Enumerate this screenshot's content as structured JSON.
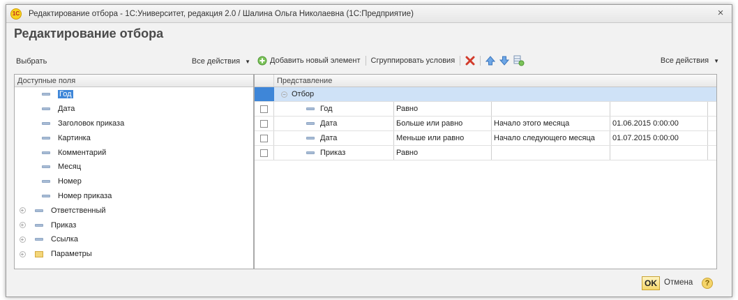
{
  "window": {
    "title": "Редактирование отбора - 1С:Университет, редакция 2.0 / Шалина Ольга Николаевна  (1С:Предприятие)",
    "logo_text": "1С",
    "close_glyph": "×"
  },
  "form": {
    "title": "Редактирование отбора"
  },
  "left_toolbar": {
    "select_label": "Выбрать",
    "all_actions_label": "Все действия"
  },
  "right_toolbar": {
    "add_label": "Добавить новый элемент",
    "group_label": "Сгруппировать условия",
    "all_actions_label": "Все действия"
  },
  "left_panel": {
    "header": "Доступные поля",
    "items": [
      {
        "label": "Год",
        "icon": "field-icon",
        "expandable": false,
        "selected": true
      },
      {
        "label": "Дата",
        "icon": "field-icon",
        "expandable": false
      },
      {
        "label": "Заголовок приказа",
        "icon": "field-icon",
        "expandable": false
      },
      {
        "label": "Картинка",
        "icon": "field-icon",
        "expandable": false
      },
      {
        "label": "Комментарий",
        "icon": "field-icon",
        "expandable": false
      },
      {
        "label": "Месяц",
        "icon": "field-icon",
        "expandable": false
      },
      {
        "label": "Номер",
        "icon": "field-icon",
        "expandable": false
      },
      {
        "label": "Номер приказа",
        "icon": "field-icon",
        "expandable": false
      },
      {
        "label": "Ответственный",
        "icon": "field-icon",
        "expandable": true
      },
      {
        "label": "Приказ",
        "icon": "field-icon",
        "expandable": true
      },
      {
        "label": "Ссылка",
        "icon": "field-icon",
        "expandable": true
      },
      {
        "label": "Параметры",
        "icon": "folder-icon",
        "expandable": true
      }
    ]
  },
  "right_panel": {
    "header": "Представление",
    "group_label": "Отбор",
    "rows": [
      {
        "field": "Год",
        "comparison": "Равно",
        "value": "",
        "extra": ""
      },
      {
        "field": "Дата",
        "comparison": "Больше или равно",
        "value": "Начало этого месяца",
        "extra": "01.06.2015 0:00:00"
      },
      {
        "field": "Дата",
        "comparison": "Меньше или равно",
        "value": "Начало следующего месяца",
        "extra": "01.07.2015 0:00:00"
      },
      {
        "field": "Приказ",
        "comparison": "Равно",
        "value": "",
        "extra": ""
      }
    ]
  },
  "footer": {
    "ok_label": "OK",
    "cancel_label": "Отмена",
    "help_label": "?"
  },
  "colors": {
    "title_color": "#4a4a4a",
    "selection": "#3e86d8",
    "group_row": "#cfe2f7",
    "delete_icon": "#d23b2b"
  }
}
